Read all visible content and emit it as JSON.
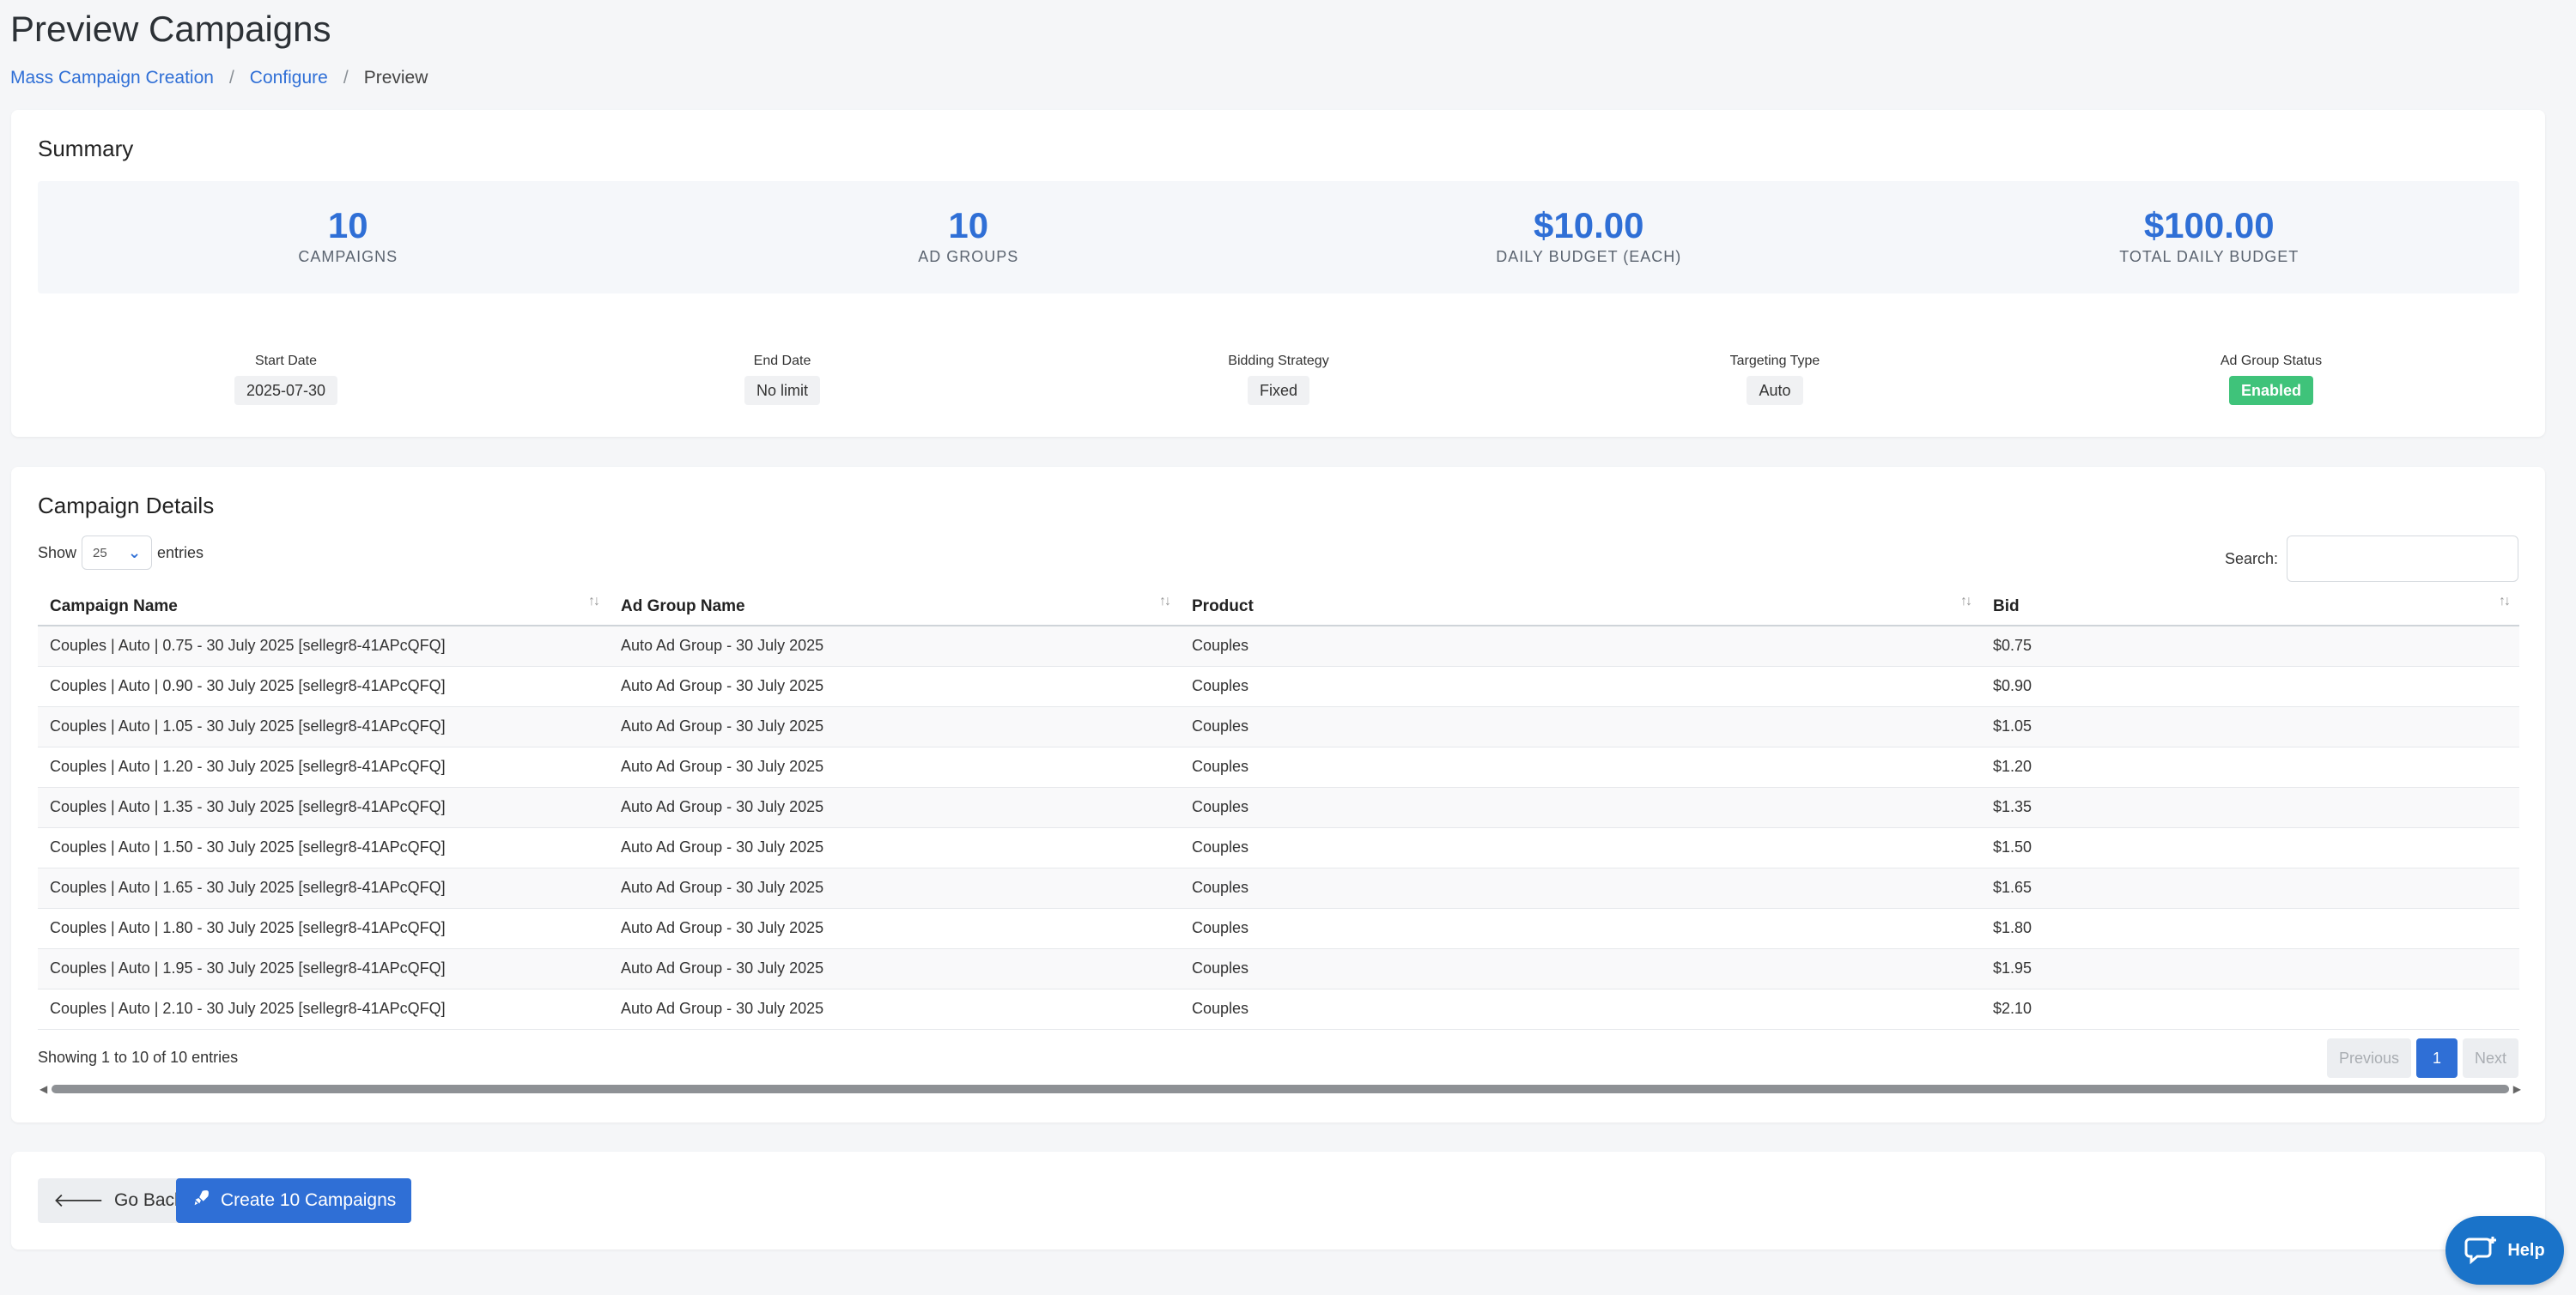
{
  "page": {
    "title": "Preview Campaigns"
  },
  "breadcrumb": {
    "items": [
      "Mass Campaign Creation",
      "Configure"
    ],
    "separator": "/",
    "current": "Preview"
  },
  "summary": {
    "title": "Summary",
    "stats": [
      {
        "value": "10",
        "label": "CAMPAIGNS"
      },
      {
        "value": "10",
        "label": "AD GROUPS"
      },
      {
        "value": "$10.00",
        "label": "DAILY BUDGET (EACH)"
      },
      {
        "value": "$100.00",
        "label": "TOTAL DAILY BUDGET"
      }
    ],
    "meta": [
      {
        "label": "Start Date",
        "value": "2025-07-30"
      },
      {
        "label": "End Date",
        "value": "No limit"
      },
      {
        "label": "Bidding Strategy",
        "value": "Fixed"
      },
      {
        "label": "Targeting Type",
        "value": "Auto"
      },
      {
        "label": "Ad Group Status",
        "value": "Enabled"
      }
    ]
  },
  "details": {
    "title": "Campaign Details",
    "show_label": "Show",
    "page_length": "25",
    "entries_label": "entries",
    "search_label": "Search:",
    "search_value": "",
    "columns": [
      "Campaign Name",
      "Ad Group Name",
      "Product",
      "Bid"
    ],
    "rows": [
      [
        "Couples | Auto | 0.75 - 30 July 2025 [sellegr8-41APcQFQ]",
        "Auto Ad Group - 30 July 2025",
        "Couples",
        "$0.75"
      ],
      [
        "Couples | Auto | 0.90 - 30 July 2025 [sellegr8-41APcQFQ]",
        "Auto Ad Group - 30 July 2025",
        "Couples",
        "$0.90"
      ],
      [
        "Couples | Auto | 1.05 - 30 July 2025 [sellegr8-41APcQFQ]",
        "Auto Ad Group - 30 July 2025",
        "Couples",
        "$1.05"
      ],
      [
        "Couples | Auto | 1.20 - 30 July 2025 [sellegr8-41APcQFQ]",
        "Auto Ad Group - 30 July 2025",
        "Couples",
        "$1.20"
      ],
      [
        "Couples | Auto | 1.35 - 30 July 2025 [sellegr8-41APcQFQ]",
        "Auto Ad Group - 30 July 2025",
        "Couples",
        "$1.35"
      ],
      [
        "Couples | Auto | 1.50 - 30 July 2025 [sellegr8-41APcQFQ]",
        "Auto Ad Group - 30 July 2025",
        "Couples",
        "$1.50"
      ],
      [
        "Couples | Auto | 1.65 - 30 July 2025 [sellegr8-41APcQFQ]",
        "Auto Ad Group - 30 July 2025",
        "Couples",
        "$1.65"
      ],
      [
        "Couples | Auto | 1.80 - 30 July 2025 [sellegr8-41APcQFQ]",
        "Auto Ad Group - 30 July 2025",
        "Couples",
        "$1.80"
      ],
      [
        "Couples | Auto | 1.95 - 30 July 2025 [sellegr8-41APcQFQ]",
        "Auto Ad Group - 30 July 2025",
        "Couples",
        "$1.95"
      ],
      [
        "Couples | Auto | 2.10 - 30 July 2025 [sellegr8-41APcQFQ]",
        "Auto Ad Group - 30 July 2025",
        "Couples",
        "$2.10"
      ]
    ],
    "info": "Showing 1 to 10 of 10 entries",
    "pager": {
      "previous": "Previous",
      "current": "1",
      "next": "Next"
    }
  },
  "actions": {
    "back_label": "Go Back",
    "back_icon": "arrow-left-icon",
    "create_label": "Create 10 Campaigns",
    "create_icon": "rocket-icon"
  },
  "help": {
    "label": "Help",
    "icon": "chat-help-icon"
  },
  "colors": {
    "accent": "#2f6fd6",
    "success": "#3fc37a",
    "help": "#1a73c9"
  }
}
